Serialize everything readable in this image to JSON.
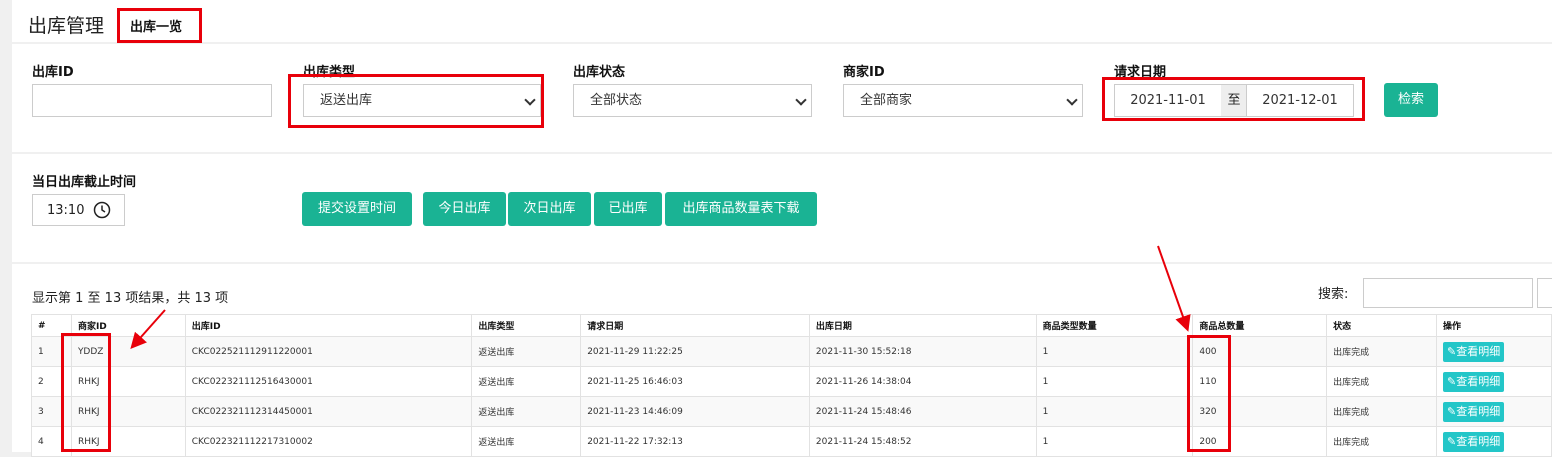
{
  "header": {
    "title": "出库管理",
    "subtitle": "出库一览"
  },
  "filters": {
    "shipment_id": {
      "label": "出库ID",
      "value": ""
    },
    "shipment_type": {
      "label": "出库类型",
      "value": "返送出库"
    },
    "shipment_status": {
      "label": "出库状态",
      "value": "全部状态"
    },
    "merchant_id": {
      "label": "商家ID",
      "value": "全部商家"
    },
    "request_date": {
      "label": "请求日期",
      "from": "2021-11-01",
      "separator": "至",
      "to": "2021-12-01"
    },
    "search_button": "检索"
  },
  "cutoff": {
    "label": "当日出库截止时间",
    "time": "13:10",
    "buttons": [
      "提交设置时间",
      "今日出库",
      "次日出库",
      "已出库",
      "出库商品数量表下载"
    ]
  },
  "results": {
    "summary": "显示第 1 至 13 项结果，共 13 项",
    "search_label": "搜索:",
    "columns": [
      "#",
      "商家ID",
      "出库ID",
      "出库类型",
      "请求日期",
      "出库日期",
      "商品类型数量",
      "商品总数量",
      "状态",
      "操作"
    ],
    "rows": [
      [
        "1",
        "YDDZ",
        "CKC022521112911220001",
        "返送出库",
        "2021-11-29 11:22:25",
        "2021-11-30 15:52:18",
        "1",
        "400",
        "出库完成",
        "查看明细"
      ],
      [
        "2",
        "RHKJ",
        "CKC022321112516430001",
        "返送出库",
        "2021-11-25 16:46:03",
        "2021-11-26 14:38:04",
        "1",
        "110",
        "出库完成",
        "查看明细"
      ],
      [
        "3",
        "RHKJ",
        "CKC022321112314450001",
        "返送出库",
        "2021-11-23 14:46:09",
        "2021-11-24 15:48:46",
        "1",
        "320",
        "出库完成",
        "查看明细"
      ],
      [
        "4",
        "RHKJ",
        "CKC022321112217310002",
        "返送出库",
        "2021-11-22 17:32:13",
        "2021-11-24 15:48:52",
        "1",
        "200",
        "出库完成",
        "查看明细"
      ]
    ]
  },
  "colors": {
    "accent": "#1ab394",
    "info": "#23c6c8",
    "highlight": "#e8000a"
  }
}
